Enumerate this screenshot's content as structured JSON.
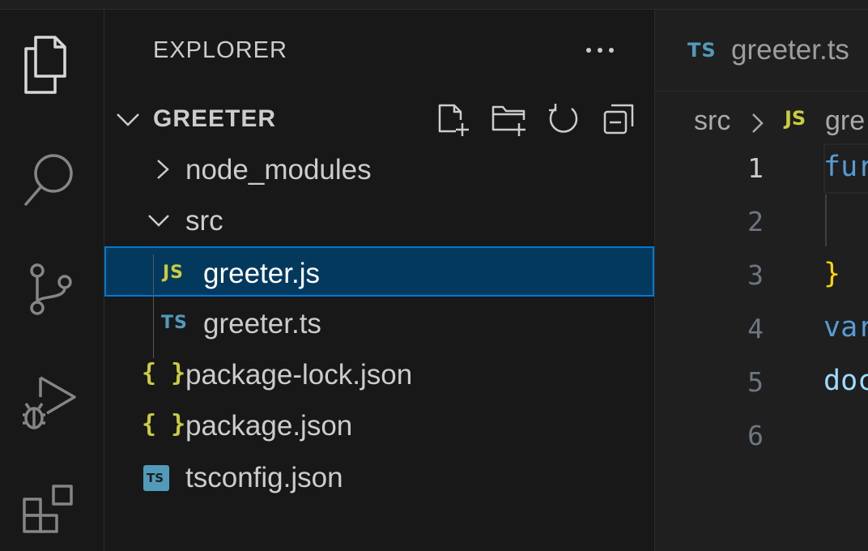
{
  "explorer": {
    "title": "EXPLORER",
    "project": "GREETER",
    "tree": [
      {
        "label": "node_modules",
        "type": "folder",
        "expanded": false
      },
      {
        "label": "src",
        "type": "folder",
        "expanded": true
      },
      {
        "label": "greeter.js",
        "badge": "JS",
        "selected": true
      },
      {
        "label": "greeter.ts",
        "badge": "TS"
      },
      {
        "label": "package-lock.json",
        "badge": "{ }"
      },
      {
        "label": "package.json",
        "badge": "{ }"
      },
      {
        "label": "tsconfig.json",
        "badge": "TS"
      }
    ]
  },
  "editor": {
    "tab": {
      "badge": "TS",
      "label": "greeter.ts"
    },
    "breadcrumb": {
      "folder": "src",
      "badge": "JS",
      "file": "gre"
    },
    "lines": [
      {
        "num": "1",
        "text": "fur",
        "color": "#569cd6"
      },
      {
        "num": "2",
        "text": "",
        "color": "#cccccc"
      },
      {
        "num": "3",
        "text": "}",
        "color": "#ffd700"
      },
      {
        "num": "4",
        "text": "var",
        "color": "#569cd6"
      },
      {
        "num": "5",
        "text": "doc",
        "color": "#9cdcfe"
      },
      {
        "num": "6",
        "text": "",
        "color": "#cccccc"
      }
    ]
  },
  "activity_bar": [
    "explorer-icon",
    "search-icon",
    "source-control-icon",
    "run-debug-icon",
    "extensions-icon"
  ]
}
